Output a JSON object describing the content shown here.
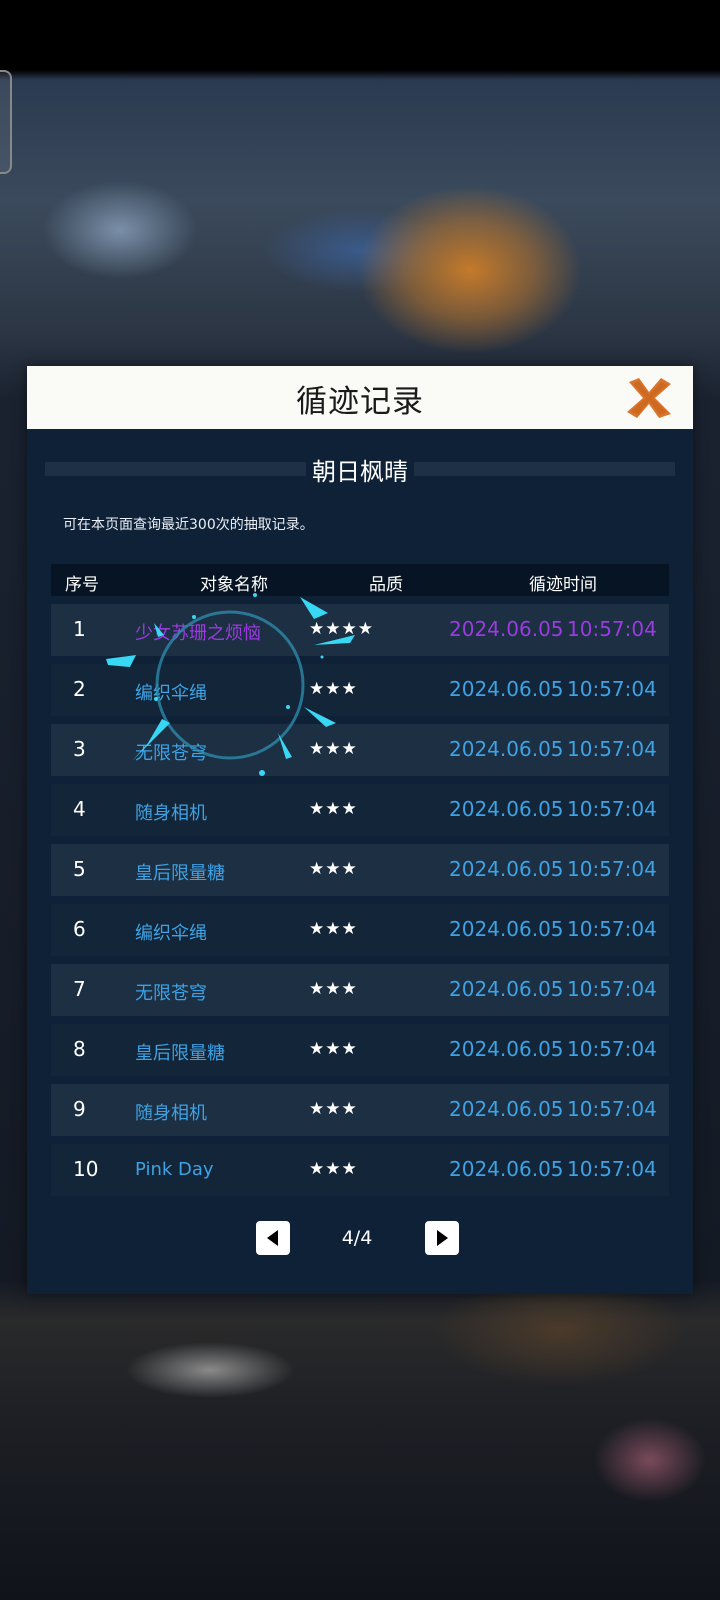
{
  "dialog": {
    "title": "循迹记录",
    "subtitle": "朝日枫晴",
    "note": "可在本页面查询最近300次的抽取记录。"
  },
  "table": {
    "headers": {
      "index": "序号",
      "name": "对象名称",
      "quality": "品质",
      "time": "循迹时间"
    },
    "rows": [
      {
        "index": "1",
        "name": "少女苏珊之烦恼",
        "quality": "★★★★",
        "date": "2024.06.05",
        "time": "10:57:04",
        "rarity": "purple"
      },
      {
        "index": "2",
        "name": "编织伞绳",
        "quality": "★★★",
        "date": "2024.06.05",
        "time": "10:57:04",
        "rarity": "blue"
      },
      {
        "index": "3",
        "name": "无限苍穹",
        "quality": "★★★",
        "date": "2024.06.05",
        "time": "10:57:04",
        "rarity": "blue"
      },
      {
        "index": "4",
        "name": "随身相机",
        "quality": "★★★",
        "date": "2024.06.05",
        "time": "10:57:04",
        "rarity": "blue"
      },
      {
        "index": "5",
        "name": "皇后限量糖",
        "quality": "★★★",
        "date": "2024.06.05",
        "time": "10:57:04",
        "rarity": "blue"
      },
      {
        "index": "6",
        "name": "编织伞绳",
        "quality": "★★★",
        "date": "2024.06.05",
        "time": "10:57:04",
        "rarity": "blue"
      },
      {
        "index": "7",
        "name": "无限苍穹",
        "quality": "★★★",
        "date": "2024.06.05",
        "time": "10:57:04",
        "rarity": "blue"
      },
      {
        "index": "8",
        "name": "皇后限量糖",
        "quality": "★★★",
        "date": "2024.06.05",
        "time": "10:57:04",
        "rarity": "blue"
      },
      {
        "index": "9",
        "name": "随身相机",
        "quality": "★★★",
        "date": "2024.06.05",
        "time": "10:57:04",
        "rarity": "blue"
      },
      {
        "index": "10",
        "name": "Pink Day",
        "quality": "★★★",
        "date": "2024.06.05",
        "time": "10:57:04",
        "rarity": "blue"
      }
    ]
  },
  "pager": {
    "label": "4/4"
  },
  "colors": {
    "accent_blue": "#3ea2e4",
    "accent_purple": "#9b3be0",
    "close_orange": "#d9742a",
    "dialog_bg": "#0f2137"
  },
  "icons": {
    "close": "close-icon",
    "prev": "triangle-left-icon",
    "next": "triangle-right-icon",
    "loading": "loading-spinner-icon"
  }
}
